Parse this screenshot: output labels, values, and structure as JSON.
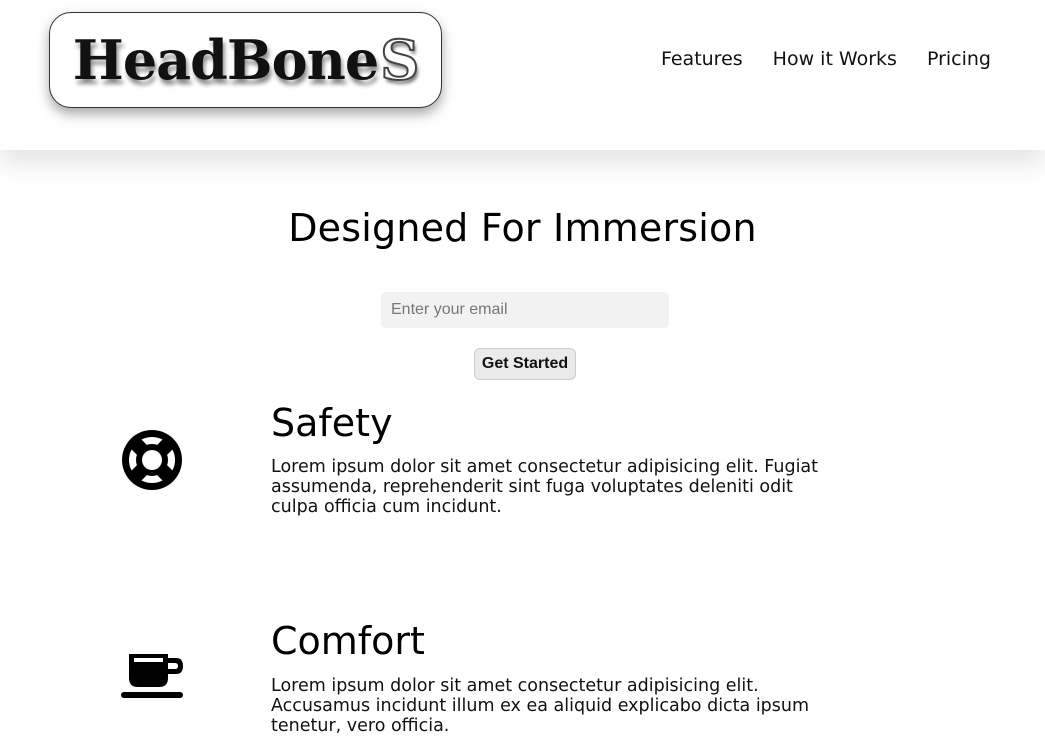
{
  "header": {
    "logo_text": "HeadBone",
    "logo_tail": "S",
    "nav": [
      {
        "label": "Features"
      },
      {
        "label": "How it Works"
      },
      {
        "label": "Pricing"
      }
    ]
  },
  "hero": {
    "title": "Designed For Immersion",
    "email_placeholder": "Enter your email",
    "cta_label": "Get Started"
  },
  "features": [
    {
      "icon": "life-ring-icon",
      "title": "Safety",
      "description": "Lorem ipsum dolor sit amet consectetur adipisicing elit. Fugiat assumenda, reprehenderit sint fuga voluptates deleniti odit culpa officia cum incidunt."
    },
    {
      "icon": "coffee-cup-icon",
      "title": "Comfort",
      "description": "Lorem ipsum dolor sit amet consectetur adipisicing elit. Accusamus incidunt illum ex ea aliquid explicabo dicta ipsum tenetur, vero officia."
    }
  ]
}
